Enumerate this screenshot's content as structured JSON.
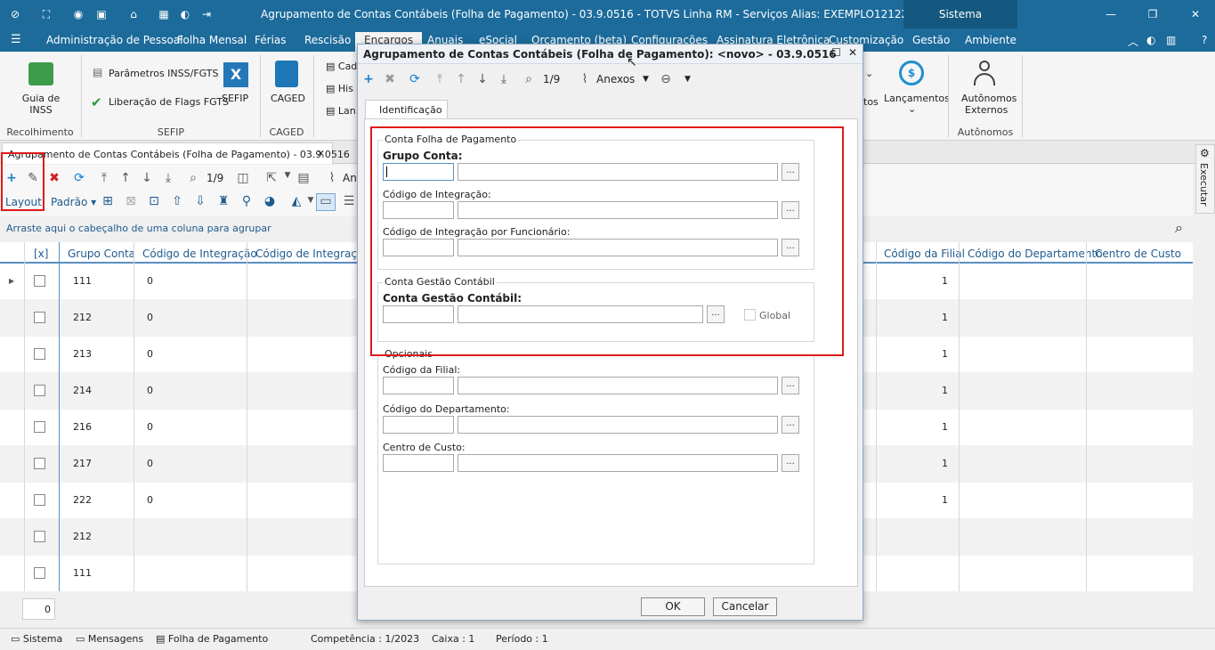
{
  "window": {
    "title": "Agrupamento de Contas Contábeis (Folha de Pagamento) - 03.9.0516 - TOTVS Linha RM - Serviços  Alias: EXEMPLO1212209 | 1-TOTVS SA",
    "sistema_tab": "Sistema"
  },
  "menu": {
    "items": [
      "Administração de Pessoal",
      "Folha Mensal",
      "Férias",
      "Rescisão",
      "Encargos",
      "Anuais",
      "eSocial",
      "Orçamento (beta)",
      "Configurações",
      "Assinatura Eletrônica",
      "Customização",
      "Gestão",
      "Ambiente"
    ],
    "active": "Encargos"
  },
  "ribbon": {
    "guia_inss": "Guia de\nINSS",
    "recolhimento": "Recolhimento",
    "parametros": "Parâmetros INSS/FGTS",
    "liberacao": "Liberação de Flags FGTS",
    "sefip_btn": "SEFIP",
    "sefip_grp": "SEFIP",
    "caged_btn": "CAGED",
    "caged_grp": "CAGED",
    "cad": "Cad",
    "his": "His",
    "lan": "Lan",
    "tos": "tos",
    "lancamentos": "Lançamentos",
    "autonomos_btn_1": "Autônomos",
    "autonomos_btn_2": "Externos",
    "autonomos_grp": "Autônomos"
  },
  "doctab": {
    "label": "Agrupamento de Contas Contábeis (Folha de Pagamento) - 03.9.0516"
  },
  "toolbar": {
    "page": "1/9",
    "anexos_partial": "An",
    "layout_label": "Layout:",
    "layout_value": "Padrão"
  },
  "grid": {
    "group_hint": "Arraste aqui o cabeçalho de uma coluna para agrupar",
    "headers": [
      "[x]",
      "Grupo Conta",
      "Código de Integração",
      "Código de Integração p",
      "Código da Filial",
      "Código do Departamento",
      "Centro de Custo"
    ],
    "rows": [
      {
        "grupo": "111",
        "integ": "0",
        "filial": "1"
      },
      {
        "grupo": "212",
        "integ": "0",
        "filial": "1"
      },
      {
        "grupo": "213",
        "integ": "0",
        "filial": "1"
      },
      {
        "grupo": "214",
        "integ": "0",
        "filial": "1"
      },
      {
        "grupo": "216",
        "integ": "0",
        "filial": "1"
      },
      {
        "grupo": "217",
        "integ": "0",
        "filial": "1"
      },
      {
        "grupo": "222",
        "integ": "0",
        "filial": "1"
      },
      {
        "grupo": "212",
        "integ": "",
        "filial": ""
      },
      {
        "grupo": "111",
        "integ": "",
        "filial": ""
      }
    ],
    "footer_count": "0"
  },
  "dialog": {
    "title": "Agrupamento de Contas Contábeis (Folha de Pagamento): <novo> - 03.9.0516",
    "page": "1/9",
    "anexos": "Anexos",
    "tab": "Identificação",
    "fs1_legend": "Conta Folha de Pagamento",
    "grupo_conta": "Grupo Conta:",
    "cod_integracao": "Código de Integração:",
    "cod_integracao_func": "Código de Integração por Funcionário:",
    "fs2_legend": "Conta Gestão Contábil",
    "conta_gestao": "Conta Gestão Contábil:",
    "global": "Global",
    "fs3_legend": "Opcionais",
    "cod_filial": "Código da Filial:",
    "cod_departamento": "Código do Departamento:",
    "centro_custo": "Centro de Custo:",
    "ellipsis": "...",
    "ok": "OK",
    "cancelar": "Cancelar"
  },
  "statusbar": {
    "sistema": "Sistema",
    "mensagens": "Mensagens",
    "folha": "Folha de Pagamento",
    "competencia": "Competência : 1/2023",
    "caixa": "Caixa : 1",
    "periodo": "Período : 1"
  },
  "executar": "Executar",
  "colors": {
    "titlebar": "#1c6b9b",
    "highlight": "#e01a1a",
    "header_text": "#1f5b8e"
  }
}
